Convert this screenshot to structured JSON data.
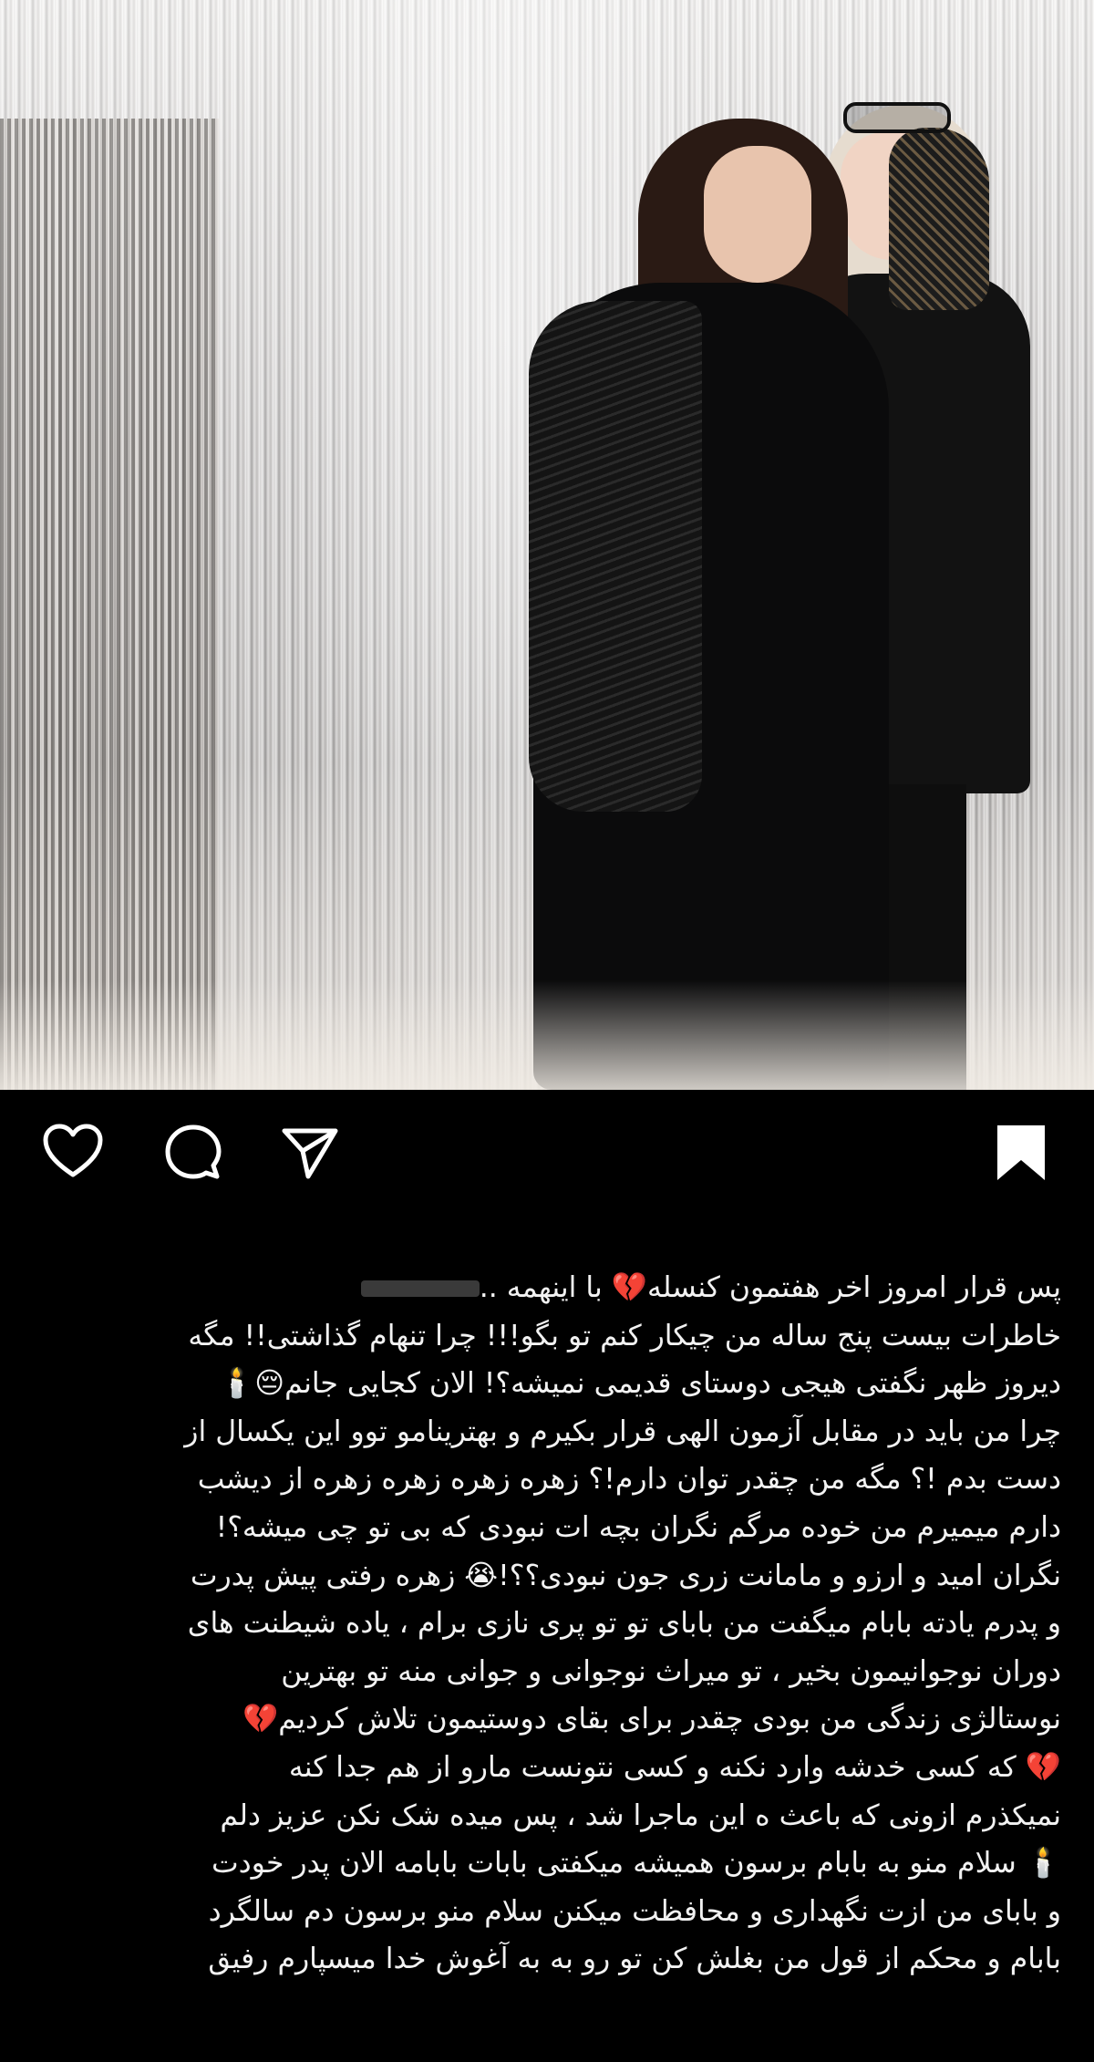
{
  "post": {
    "photo_alt": "",
    "caption_lines": [
      "پس قرار امروز اخر هفتمون کنسله💔 با اینهمه ..",
      "خاطرات بیست پنج ساله من چیکار کنم تو بگو!!! چرا تنهام گذاشتی!! مگه",
      "دیروز ظهر نگفتی هیجی دوستای قدیمی نمیشه؟! الان کجایی جانم😔🕯️",
      "چرا من باید در مقابل آزمون الهی قرار بکیرم و بهترینامو توو این یکسال از",
      "دست بدم !؟ مگه من چقدر توان دارم!؟ زهره زهره زهره زهره از دیشب",
      "دارم میمیرم من خوده مرگم نگران بچه ات نبودی که بی تو چی میشه؟!",
      "نگران امید و ارزو و مامانت زری جون نبودی؟؟!😭 زهره رفتی پیش پدرت",
      "و پدرم یادته بابام میگفت من بابای تو تو پری نازی برام ، یاده شیطنت های",
      "دوران نوجوانیمون بخیر ، تو میراث نوجوانی و جوانی منه تو بهترین",
      "نوستالژی زندگی من بودی چقدر برای بقای دوستیمون تلاش کردیم💔",
      "💔 که کسی خدشه وارد نکنه و کسی نتونست مارو از هم جدا کنه",
      "نمیکذرم ازونی که باعث ه این ماجرا شد ، پس میده شک نکن عزیز دلم",
      "🕯️ سلام منو به بابام برسون همیشه میکفتی بابات بابامه الان پدر خودت",
      "و بابای من ازت نگهداری و محافظت میکنن سلام منو برسون دم سالگرد",
      "بابام و محکم از قول من بغلش کن تو رو به به آغوش خدا میسپارم رفیق"
    ]
  },
  "actions": {
    "like_icon": "heart-outline-icon",
    "comment_icon": "comment-bubble-icon",
    "share_icon": "paper-plane-icon",
    "save_icon": "bookmark-filled-icon"
  },
  "colors": {
    "background": "#000000",
    "text": "#f2f2f2",
    "icon": "#ffffff"
  }
}
